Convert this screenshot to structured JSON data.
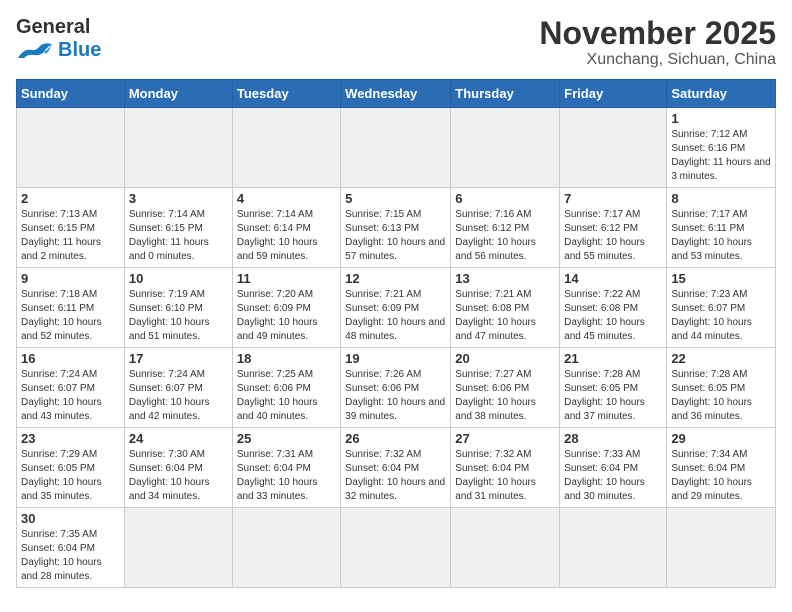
{
  "header": {
    "logo_general": "General",
    "logo_blue": "Blue",
    "month_title": "November 2025",
    "subtitle": "Xunchang, Sichuan, China"
  },
  "weekdays": [
    "Sunday",
    "Monday",
    "Tuesday",
    "Wednesday",
    "Thursday",
    "Friday",
    "Saturday"
  ],
  "weeks": [
    [
      {
        "day": "",
        "info": "",
        "empty": true
      },
      {
        "day": "",
        "info": "",
        "empty": true
      },
      {
        "day": "",
        "info": "",
        "empty": true
      },
      {
        "day": "",
        "info": "",
        "empty": true
      },
      {
        "day": "",
        "info": "",
        "empty": true
      },
      {
        "day": "",
        "info": "",
        "empty": true
      },
      {
        "day": "1",
        "info": "Sunrise: 7:12 AM\nSunset: 6:16 PM\nDaylight: 11 hours and 3 minutes.",
        "empty": false
      }
    ],
    [
      {
        "day": "2",
        "info": "Sunrise: 7:13 AM\nSunset: 6:15 PM\nDaylight: 11 hours and 2 minutes.",
        "empty": false
      },
      {
        "day": "3",
        "info": "Sunrise: 7:14 AM\nSunset: 6:15 PM\nDaylight: 11 hours and 0 minutes.",
        "empty": false
      },
      {
        "day": "4",
        "info": "Sunrise: 7:14 AM\nSunset: 6:14 PM\nDaylight: 10 hours and 59 minutes.",
        "empty": false
      },
      {
        "day": "5",
        "info": "Sunrise: 7:15 AM\nSunset: 6:13 PM\nDaylight: 10 hours and 57 minutes.",
        "empty": false
      },
      {
        "day": "6",
        "info": "Sunrise: 7:16 AM\nSunset: 6:12 PM\nDaylight: 10 hours and 56 minutes.",
        "empty": false
      },
      {
        "day": "7",
        "info": "Sunrise: 7:17 AM\nSunset: 6:12 PM\nDaylight: 10 hours and 55 minutes.",
        "empty": false
      },
      {
        "day": "8",
        "info": "Sunrise: 7:17 AM\nSunset: 6:11 PM\nDaylight: 10 hours and 53 minutes.",
        "empty": false
      }
    ],
    [
      {
        "day": "9",
        "info": "Sunrise: 7:18 AM\nSunset: 6:11 PM\nDaylight: 10 hours and 52 minutes.",
        "empty": false
      },
      {
        "day": "10",
        "info": "Sunrise: 7:19 AM\nSunset: 6:10 PM\nDaylight: 10 hours and 51 minutes.",
        "empty": false
      },
      {
        "day": "11",
        "info": "Sunrise: 7:20 AM\nSunset: 6:09 PM\nDaylight: 10 hours and 49 minutes.",
        "empty": false
      },
      {
        "day": "12",
        "info": "Sunrise: 7:21 AM\nSunset: 6:09 PM\nDaylight: 10 hours and 48 minutes.",
        "empty": false
      },
      {
        "day": "13",
        "info": "Sunrise: 7:21 AM\nSunset: 6:08 PM\nDaylight: 10 hours and 47 minutes.",
        "empty": false
      },
      {
        "day": "14",
        "info": "Sunrise: 7:22 AM\nSunset: 6:08 PM\nDaylight: 10 hours and 45 minutes.",
        "empty": false
      },
      {
        "day": "15",
        "info": "Sunrise: 7:23 AM\nSunset: 6:07 PM\nDaylight: 10 hours and 44 minutes.",
        "empty": false
      }
    ],
    [
      {
        "day": "16",
        "info": "Sunrise: 7:24 AM\nSunset: 6:07 PM\nDaylight: 10 hours and 43 minutes.",
        "empty": false
      },
      {
        "day": "17",
        "info": "Sunrise: 7:24 AM\nSunset: 6:07 PM\nDaylight: 10 hours and 42 minutes.",
        "empty": false
      },
      {
        "day": "18",
        "info": "Sunrise: 7:25 AM\nSunset: 6:06 PM\nDaylight: 10 hours and 40 minutes.",
        "empty": false
      },
      {
        "day": "19",
        "info": "Sunrise: 7:26 AM\nSunset: 6:06 PM\nDaylight: 10 hours and 39 minutes.",
        "empty": false
      },
      {
        "day": "20",
        "info": "Sunrise: 7:27 AM\nSunset: 6:06 PM\nDaylight: 10 hours and 38 minutes.",
        "empty": false
      },
      {
        "day": "21",
        "info": "Sunrise: 7:28 AM\nSunset: 6:05 PM\nDaylight: 10 hours and 37 minutes.",
        "empty": false
      },
      {
        "day": "22",
        "info": "Sunrise: 7:28 AM\nSunset: 6:05 PM\nDaylight: 10 hours and 36 minutes.",
        "empty": false
      }
    ],
    [
      {
        "day": "23",
        "info": "Sunrise: 7:29 AM\nSunset: 6:05 PM\nDaylight: 10 hours and 35 minutes.",
        "empty": false
      },
      {
        "day": "24",
        "info": "Sunrise: 7:30 AM\nSunset: 6:04 PM\nDaylight: 10 hours and 34 minutes.",
        "empty": false
      },
      {
        "day": "25",
        "info": "Sunrise: 7:31 AM\nSunset: 6:04 PM\nDaylight: 10 hours and 33 minutes.",
        "empty": false
      },
      {
        "day": "26",
        "info": "Sunrise: 7:32 AM\nSunset: 6:04 PM\nDaylight: 10 hours and 32 minutes.",
        "empty": false
      },
      {
        "day": "27",
        "info": "Sunrise: 7:32 AM\nSunset: 6:04 PM\nDaylight: 10 hours and 31 minutes.",
        "empty": false
      },
      {
        "day": "28",
        "info": "Sunrise: 7:33 AM\nSunset: 6:04 PM\nDaylight: 10 hours and 30 minutes.",
        "empty": false
      },
      {
        "day": "29",
        "info": "Sunrise: 7:34 AM\nSunset: 6:04 PM\nDaylight: 10 hours and 29 minutes.",
        "empty": false
      }
    ],
    [
      {
        "day": "30",
        "info": "Sunrise: 7:35 AM\nSunset: 6:04 PM\nDaylight: 10 hours and 28 minutes.",
        "empty": false
      },
      {
        "day": "",
        "info": "",
        "empty": true
      },
      {
        "day": "",
        "info": "",
        "empty": true
      },
      {
        "day": "",
        "info": "",
        "empty": true
      },
      {
        "day": "",
        "info": "",
        "empty": true
      },
      {
        "day": "",
        "info": "",
        "empty": true
      },
      {
        "day": "",
        "info": "",
        "empty": true
      }
    ]
  ]
}
